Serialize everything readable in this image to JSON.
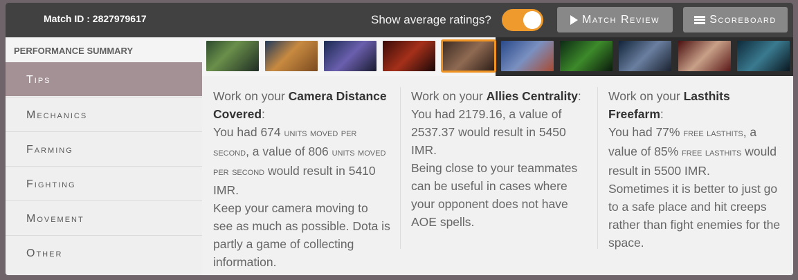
{
  "header": {
    "match_id": "Match ID : 2827979617",
    "toggle_label": "Show average ratings?",
    "match_review_label": "Match Review",
    "scoreboard_label": "Scoreboard",
    "accent_color": "#ee9a2d"
  },
  "sidebar": {
    "title": "PERFORMANCE SUMMARY",
    "items": [
      {
        "label": "Tips"
      },
      {
        "label": "Mechanics"
      },
      {
        "label": "Farming"
      },
      {
        "label": "Fighting"
      },
      {
        "label": "Movement"
      },
      {
        "label": "Other"
      }
    ]
  },
  "heroes": [
    {
      "name": "tidehunter-portrait"
    },
    {
      "name": "keeper-of-the-light-portrait"
    },
    {
      "name": "vengeful-spirit-portrait"
    },
    {
      "name": "shadow-fiend-portrait"
    },
    {
      "name": "anti-mage-portrait",
      "selected": true
    },
    {
      "name": "ogre-magi-portrait"
    },
    {
      "name": "rubick-portrait"
    },
    {
      "name": "slark-portrait"
    },
    {
      "name": "invoker-portrait"
    },
    {
      "name": "phantom-assassin-portrait"
    }
  ],
  "tips": [
    {
      "intro": "Work on your ",
      "metric": "Camera Distance Covered",
      "colon": ":",
      "you_had": "You had 674 ",
      "unit1": "units moved per second",
      "mid": ", a value of 806 ",
      "unit2": "units moved per second",
      "result": " would result in 5410 IMR.",
      "advice": "Keep your camera moving to see as much as possible. Dota is partly a game of collecting information."
    },
    {
      "intro": "Work on your ",
      "metric": "Allies Centrality",
      "colon": ":",
      "you_had": "You had 2179.16, a value of 2537.37 would result in 5450 IMR.",
      "advice": "Being close to your teammates can be useful in cases where your opponent does not have AOE spells."
    },
    {
      "intro": "Work on your ",
      "metric": "Lasthits Freefarm",
      "colon": ":",
      "you_had": "You had 77% ",
      "unit1": "free lasthits",
      "mid": ", a value of 85% ",
      "unit2": "free lasthits",
      "result": " would result in 5500 IMR.",
      "advice": "Sometimes it is better to just go to a safe place and hit creeps rather than fight enemies for the space."
    }
  ]
}
